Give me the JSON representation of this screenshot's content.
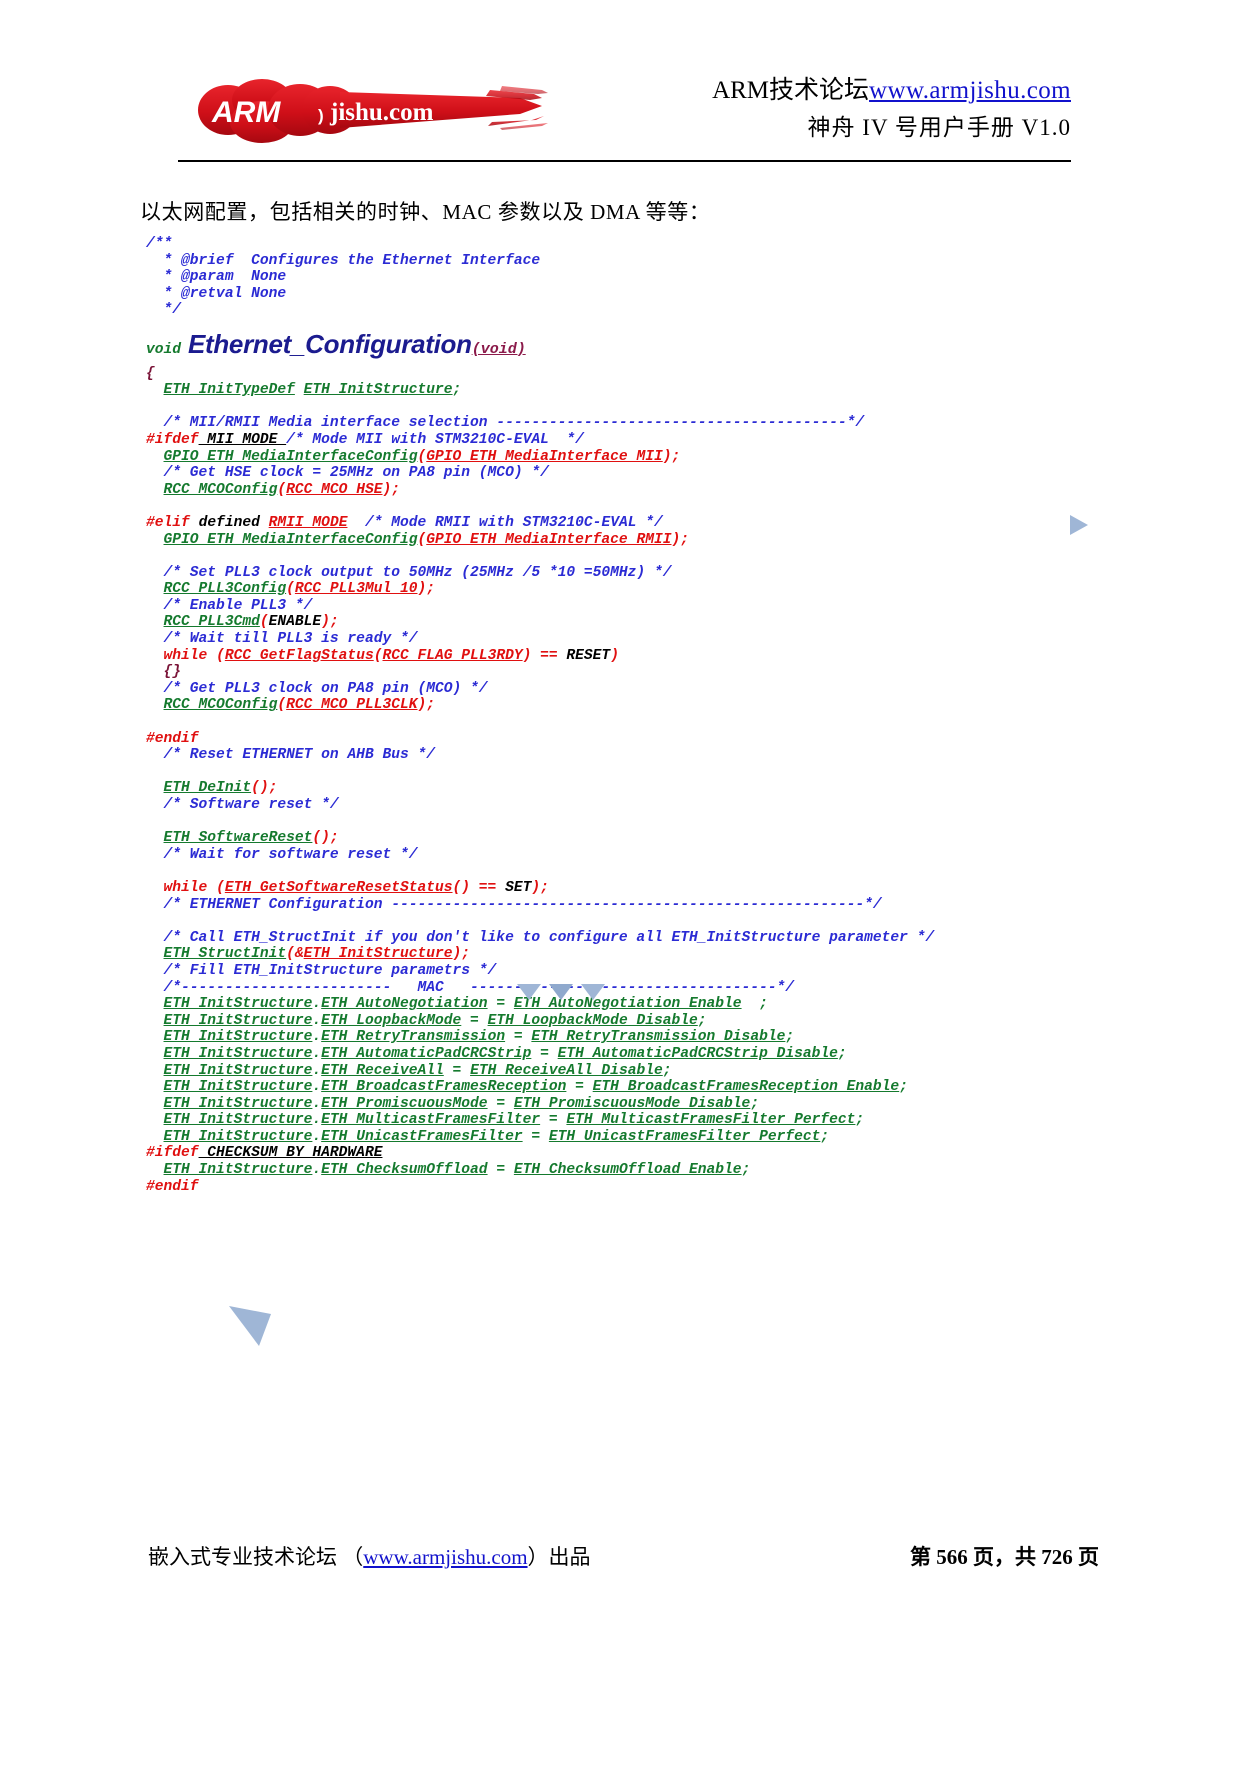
{
  "header": {
    "logo_alt": "ARMjishu.com",
    "logo_text_arm": "ARM",
    "logo_text_jishu": "jishu.com",
    "line1_prefix": "ARM技术论坛",
    "line1_url": "www.armjishu.com",
    "line2": "神舟 IV 号用户手册 V1.0"
  },
  "body": {
    "paragraph": "以太网配置，包括相关的时钟、MAC 参数以及 DMA 等等："
  },
  "code": {
    "signature": {
      "return_type": "void",
      "name": "Ethernet_Configuration",
      "params": "(void)"
    },
    "lines": [
      "/**",
      "  * @brief  Configures the Ethernet Interface",
      "  * @param  None",
      "  * @retval None",
      "  */",
      "{",
      "  ETH_InitTypeDef ETH_InitStructure;",
      "  /* MII/RMII Media interface selection ----------------------------------------*/",
      "#ifdef MII_MODE /* Mode MII with STM3210C-EVAL  */",
      "  GPIO_ETH_MediaInterfaceConfig(GPIO_ETH_MediaInterface_MII);",
      "  /* Get HSE clock = 25MHz on PA8 pin (MCO) */",
      "  RCC_MCOConfig(RCC_MCO_HSE);",
      "#elif defined RMII_MODE  /* Mode RMII with STM3210C-EVAL */",
      "  GPIO_ETH_MediaInterfaceConfig(GPIO_ETH_MediaInterface_RMII);",
      "  /* Set PLL3 clock output to 50MHz (25MHz /5 *10 =50MHz) */",
      "  RCC_PLL3Config(RCC_PLL3Mul_10);",
      "  /* Enable PLL3 */",
      "  RCC_PLL3Cmd(ENABLE);",
      "  /* Wait till PLL3 is ready */",
      "  while (RCC_GetFlagStatus(RCC_FLAG_PLL3RDY) == RESET)",
      "  {}",
      "  /* Get PLL3 clock on PA8 pin (MCO) */",
      "  RCC_MCOConfig(RCC_MCO_PLL3CLK);",
      "#endif",
      "  /* Reset ETHERNET on AHB Bus */",
      "  ETH_DeInit();",
      "  /* Software reset */",
      "  ETH_SoftwareReset();",
      "  /* Wait for software reset */",
      "  while (ETH_GetSoftwareResetStatus() == SET);",
      "  /* ETHERNET Configuration ------------------------------------------------------*/",
      "  /* Call ETH_StructInit if you don't like to configure all ETH_InitStructure parameter */",
      "  ETH_StructInit(&ETH_InitStructure);",
      "  /* Fill ETH_InitStructure parametrs */",
      "  /*------------------------   MAC   -----------------------------------*/",
      "  ETH_InitStructure.ETH_AutoNegotiation = ETH_AutoNegotiation_Enable  ;",
      "  ETH_InitStructure.ETH_LoopbackMode = ETH_LoopbackMode_Disable;",
      "  ETH_InitStructure.ETH_RetryTransmission = ETH_RetryTransmission_Disable;",
      "  ETH_InitStructure.ETH_AutomaticPadCRCStrip = ETH_AutomaticPadCRCStrip_Disable;",
      "  ETH_InitStructure.ETH_ReceiveAll = ETH_ReceiveAll_Disable;",
      "  ETH_InitStructure.ETH_BroadcastFramesReception = ETH_BroadcastFramesReception_Enable;",
      "  ETH_InitStructure.ETH_PromiscuousMode = ETH_PromiscuousMode_Disable;",
      "  ETH_InitStructure.ETH_MulticastFramesFilter = ETH_MulticastFramesFilter_Perfect;",
      "  ETH_InitStructure.ETH_UnicastFramesFilter = ETH_UnicastFramesFilter_Perfect;",
      "#ifdef CHECKSUM_BY_HARDWARE",
      "  ETH_InitStructure.ETH_ChecksumOffload = ETH_ChecksumOffload_Enable;",
      "#endif"
    ]
  },
  "footer": {
    "left_prefix": "嵌入式专业技术论坛 （",
    "left_url": "www.armjishu.com",
    "left_suffix": "）出品",
    "right": "第 566 页，共 726 页",
    "page_current": "566",
    "page_total": "726"
  },
  "colors": {
    "comment": "#2b2bd4",
    "identifier": "#157a2e",
    "macro_arg": "#e01010",
    "keyword": "#e01010",
    "plain": "#000000",
    "signature_name": "#1b1b8f",
    "link": "#1111cc",
    "logo_red": "#d4121c"
  }
}
